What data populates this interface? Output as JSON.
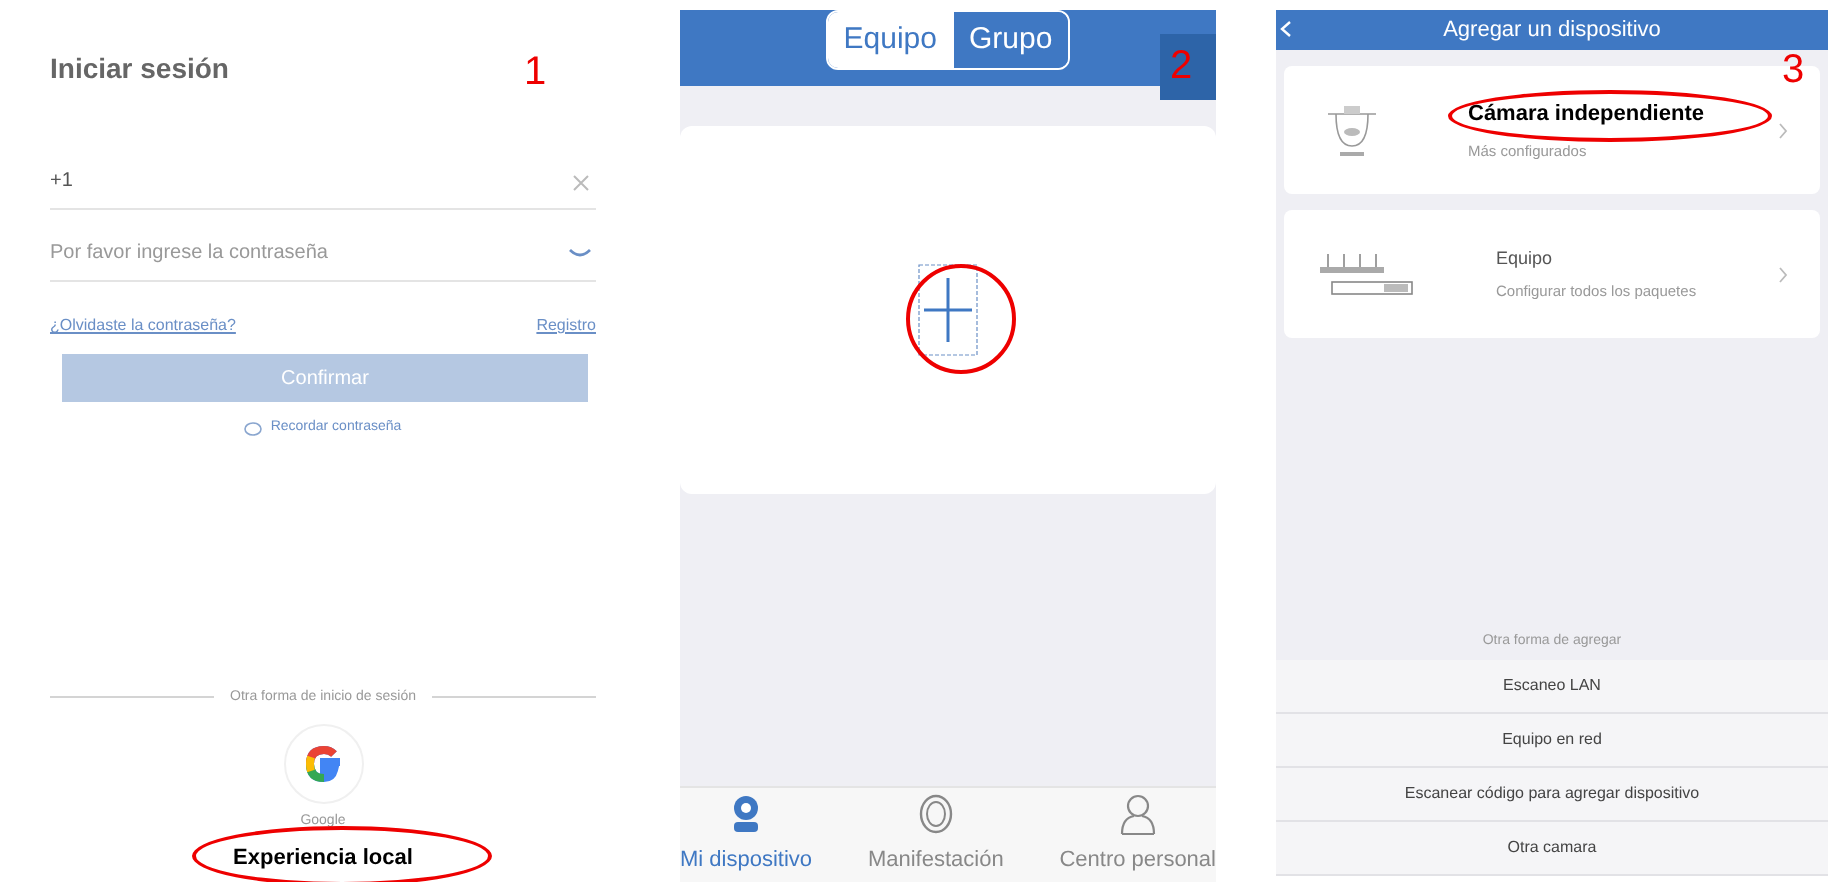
{
  "login": {
    "title": "Iniciar sesión",
    "phone": {
      "value": "+1"
    },
    "password": {
      "placeholder": "Por favor ingrese la contraseña"
    },
    "forgot_link": "¿Olvidaste la contraseña?",
    "register_link": "Registro",
    "confirm_button": {
      "label": "Confirmar",
      "disabled": true
    },
    "remember": "Recordar contraseña",
    "other_login": "Otra forma de inicio de sesión",
    "providers": [
      {
        "label": "Google"
      }
    ],
    "local_button": {
      "label": "Experiencia local",
      "highlighted": true
    }
  },
  "devices": {
    "segments": [
      {
        "label": "Equipo",
        "selected": false
      },
      {
        "label": "Grupo",
        "selected": true
      }
    ],
    "add_tile": {
      "highlighted": true
    },
    "tabs": [
      {
        "label": "Mi dispositivo",
        "selected": true
      },
      {
        "label": "Manifestación",
        "selected": false
      },
      {
        "label": "Centro personal",
        "selected": false
      }
    ]
  },
  "add_device": {
    "title": "Agregar un dispositivo",
    "options": [
      {
        "kind": "camera",
        "title": "Cámara independiente",
        "subtitle": "Más configurados",
        "highlighted": true
      },
      {
        "kind": "kit",
        "title": "Equipo",
        "subtitle": "Configurar todos los paquetes",
        "highlighted": false
      }
    ],
    "other_label": "Otra forma de agregar",
    "other_buttons": [
      "Escaneo LAN",
      "Equipo en red",
      "Escanear código para agregar dispositivo",
      "Otra camara"
    ]
  },
  "annotations": [
    {
      "label": "1"
    },
    {
      "label": "2"
    },
    {
      "label": "3"
    }
  ]
}
